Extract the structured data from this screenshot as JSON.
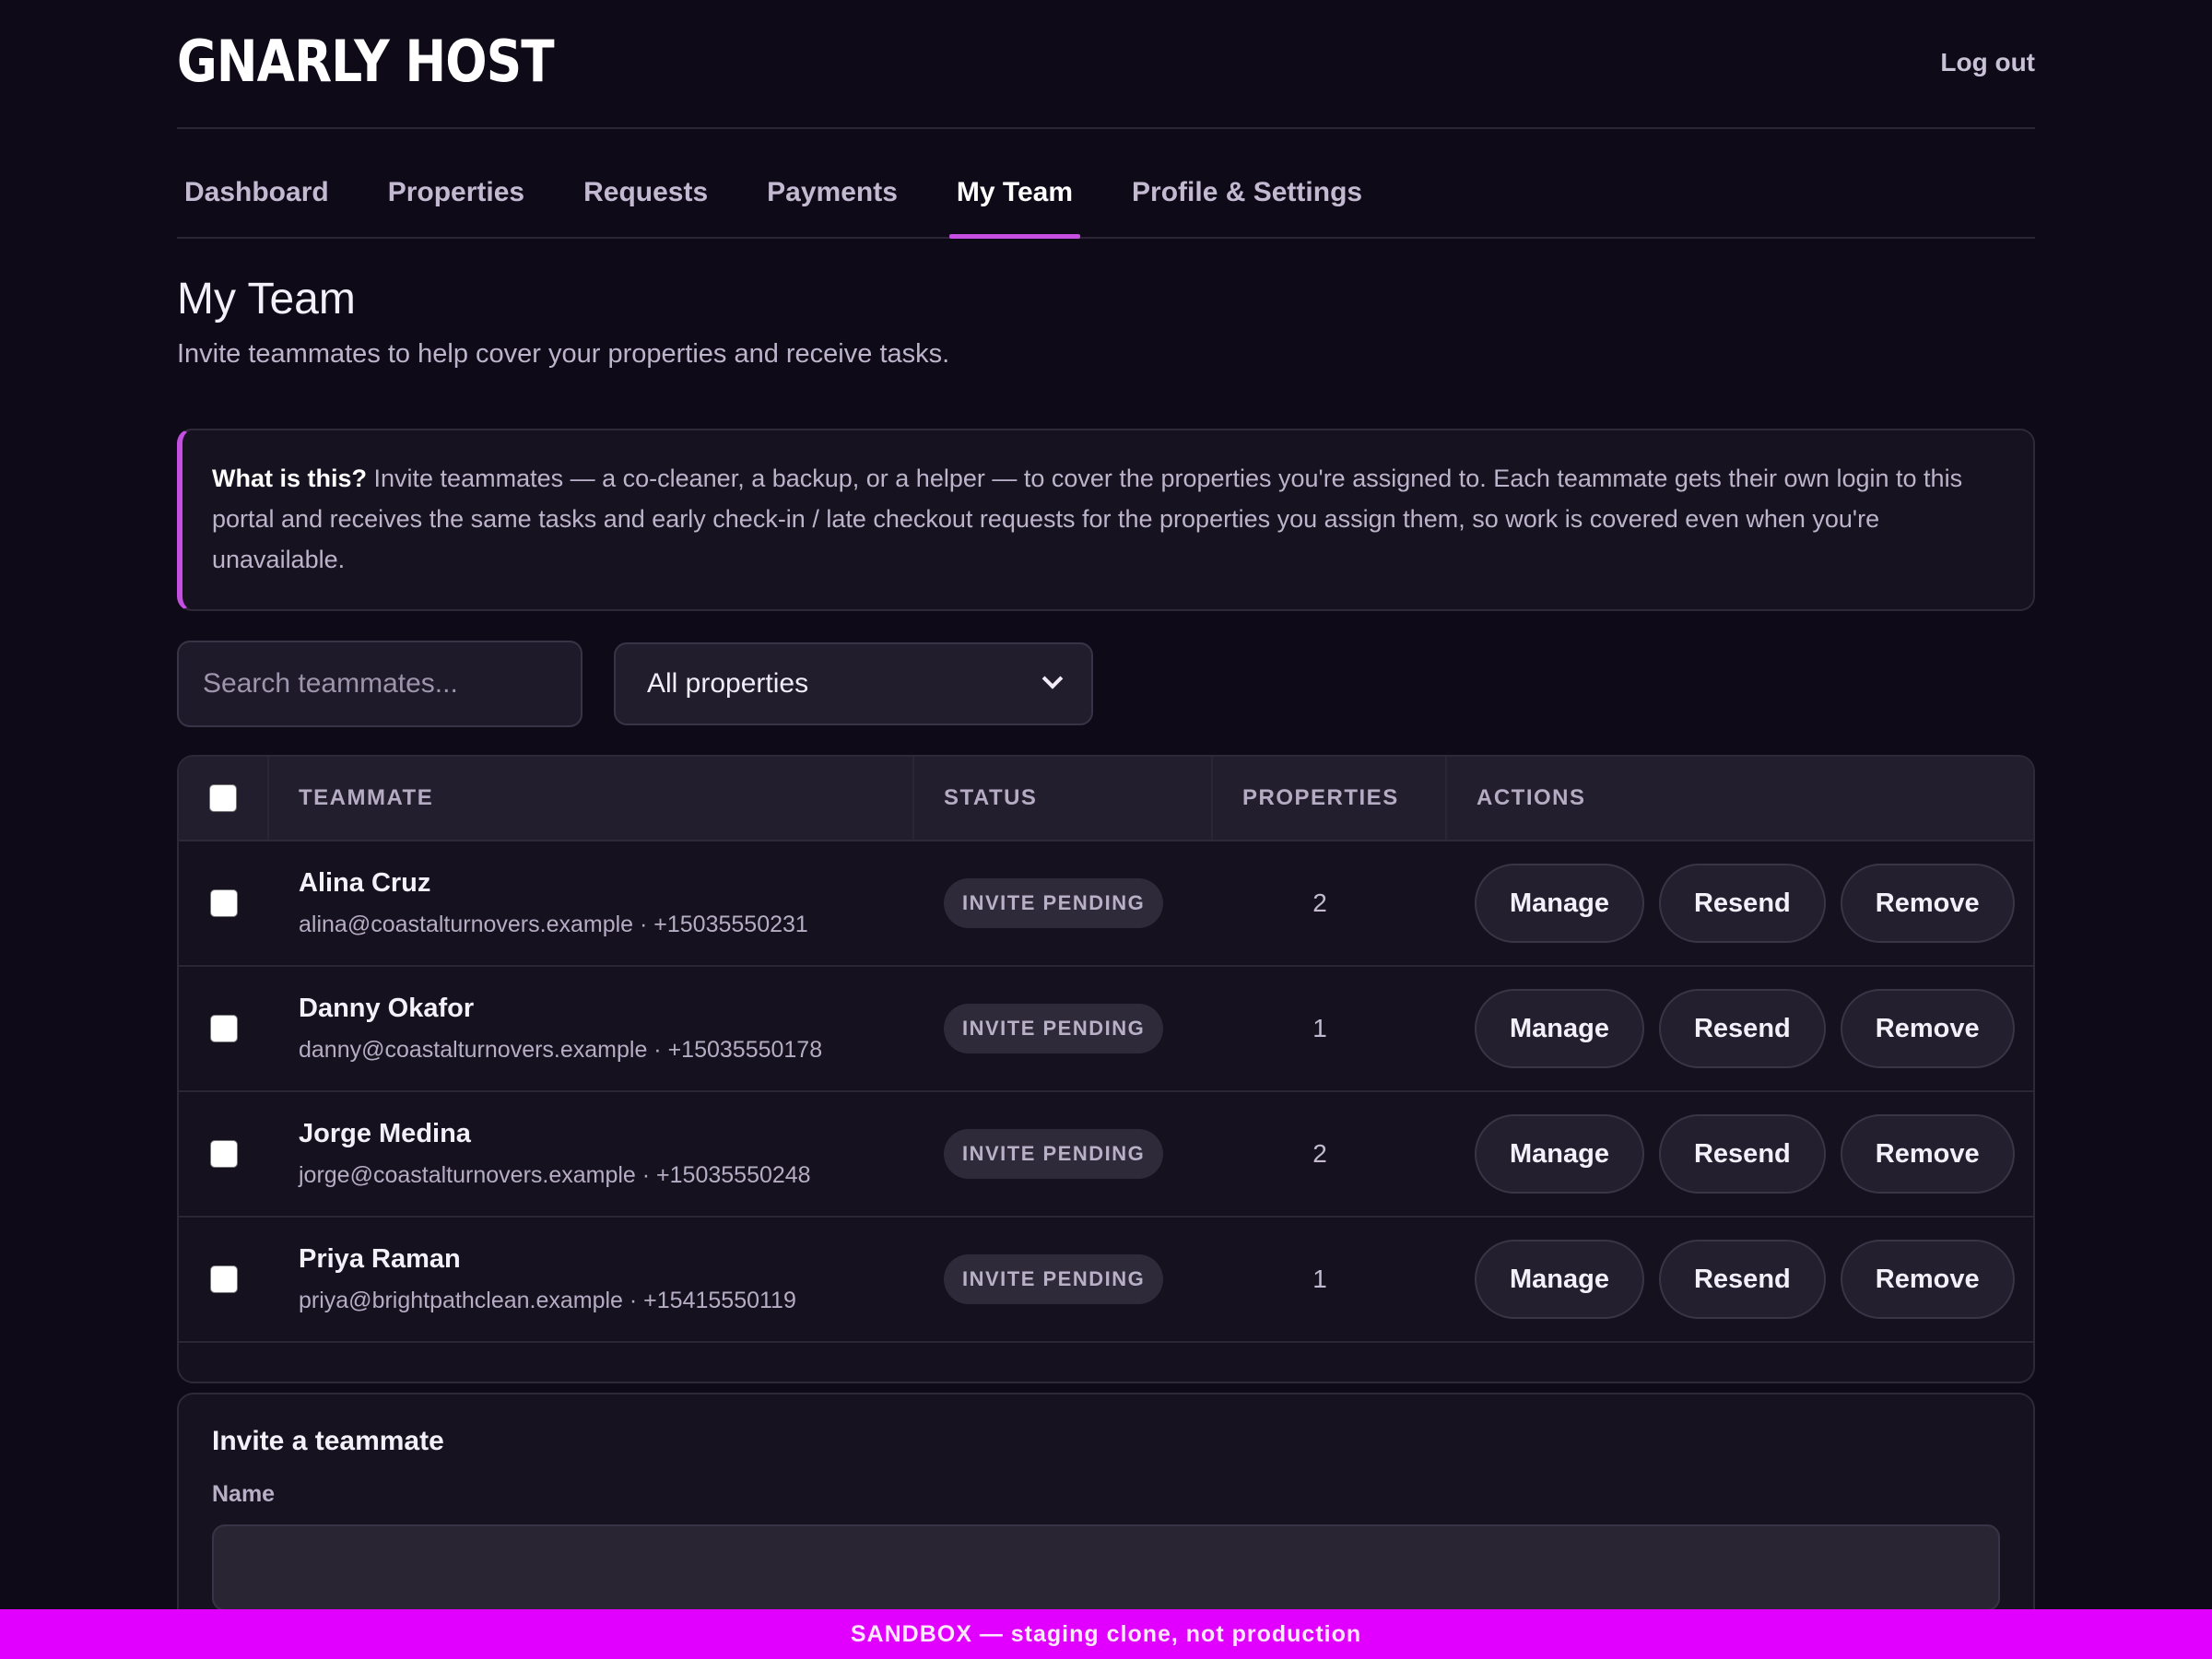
{
  "header": {
    "logo": "GNARLY HOST",
    "logout_label": "Log out"
  },
  "nav": {
    "tabs": [
      {
        "label": "Dashboard",
        "active": false
      },
      {
        "label": "Properties",
        "active": false
      },
      {
        "label": "Requests",
        "active": false
      },
      {
        "label": "Payments",
        "active": false
      },
      {
        "label": "My Team",
        "active": true
      },
      {
        "label": "Profile & Settings",
        "active": false
      }
    ]
  },
  "page": {
    "title": "My Team",
    "subtitle": "Invite teammates to help cover your properties and receive tasks."
  },
  "info": {
    "lead": "What is this?",
    "text": "Invite teammates — a co-cleaner, a backup, or a helper — to cover the properties you're assigned to. Each teammate gets their own login to this portal and receives the same tasks and early check-in / late checkout requests for the properties you assign them, so work is covered even when you're unavailable."
  },
  "filters": {
    "search_placeholder": "Search teammates...",
    "property_select": "All properties"
  },
  "table": {
    "headers": {
      "teammate": "TEAMMATE",
      "status": "STATUS",
      "properties": "PROPERTIES",
      "actions": "ACTIONS"
    },
    "rows": [
      {
        "name": "Alina Cruz",
        "contact": "alina@coastalturnovers.example · +15035550231",
        "status": "INVITE PENDING",
        "properties": "2"
      },
      {
        "name": "Danny Okafor",
        "contact": "danny@coastalturnovers.example · +15035550178",
        "status": "INVITE PENDING",
        "properties": "1"
      },
      {
        "name": "Jorge Medina",
        "contact": "jorge@coastalturnovers.example · +15035550248",
        "status": "INVITE PENDING",
        "properties": "2"
      },
      {
        "name": "Priya Raman",
        "contact": "priya@brightpathclean.example · +15415550119",
        "status": "INVITE PENDING",
        "properties": "1"
      }
    ],
    "actions": {
      "manage": "Manage",
      "resend": "Resend",
      "remove": "Remove"
    }
  },
  "invite": {
    "title": "Invite a teammate",
    "name_label": "Name"
  },
  "banner": {
    "text": "SANDBOX — staging clone, not production"
  },
  "colors": {
    "accent": "#c44fe0",
    "banner": "#e100ff",
    "background": "#0f0a18"
  }
}
